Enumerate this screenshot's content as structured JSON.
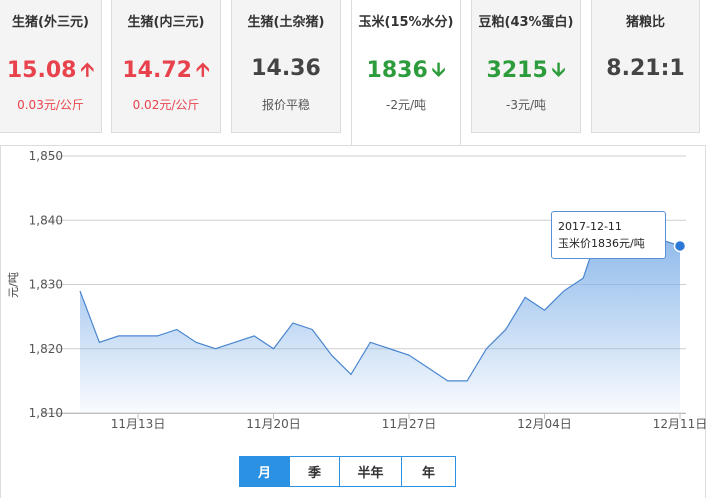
{
  "cards": [
    {
      "title": "生猪(外三元)",
      "value": "15.08",
      "change": "0.03元/公斤",
      "arrow": "up",
      "color": "#e8434c"
    },
    {
      "title": "生猪(内三元)",
      "value": "14.72",
      "change": "0.02元/公斤",
      "arrow": "up",
      "color": "#e8434c"
    },
    {
      "title": "生猪(土杂猪)",
      "value": "14.36",
      "change": "报价平稳",
      "arrow": "none",
      "color": "#444444"
    },
    {
      "title": "玉米(15%水分)",
      "value": "1836",
      "change": "-2元/吨",
      "arrow": "down",
      "color": "#2d9c3c"
    },
    {
      "title": "豆粕(43%蛋白)",
      "value": "3215",
      "change": "-3元/吨",
      "arrow": "down",
      "color": "#2d9c3c"
    },
    {
      "title": "猪粮比",
      "value": "8.21:1",
      "change": "",
      "arrow": "none",
      "color": "#444444"
    }
  ],
  "active_card": 3,
  "icons": {
    "up": "arrow-up-icon",
    "down": "arrow-down-icon"
  },
  "tooltip": {
    "date": "2017-12-11",
    "text": "玉米价1836元/吨"
  },
  "range_buttons": [
    "月",
    "季",
    "半年",
    "年"
  ],
  "active_range": 0,
  "chart_data": {
    "type": "area",
    "ylabel": "元/吨",
    "ylim": [
      1810,
      1850
    ],
    "yticks": [
      1810,
      1820,
      1830,
      1840,
      1850
    ],
    "ytick_labels": [
      "1,810",
      "1,820",
      "1,830",
      "1,840",
      "1,850"
    ],
    "xtick_labels": [
      "11月13日",
      "11月20日",
      "11月27日",
      "12月04日",
      "12月11日"
    ],
    "xtick_index": [
      3,
      10,
      17,
      24,
      31
    ],
    "grid": true,
    "area_color": "#7fb0e8",
    "line_color": "#4a86d0",
    "values": [
      1829,
      1821,
      1822,
      1822,
      1822,
      1823,
      1821,
      1820,
      1821,
      1822,
      1820,
      1824,
      1823,
      1819,
      1816,
      1821,
      1820,
      1819,
      1817,
      1815,
      1815,
      1820,
      1823,
      1828,
      1826,
      1829,
      1831,
      1840,
      1839,
      1838,
      1837,
      1836
    ],
    "highlight_index": 31
  }
}
